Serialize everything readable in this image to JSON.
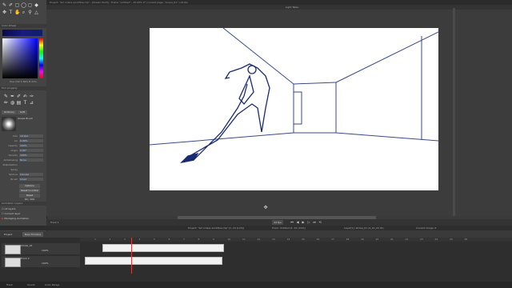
{
  "window": {
    "title": "Project: \"art orders workflow.clip\" - [Dream Paint] - Frame \"untitled\" - 25.00% 0° (current page: \"scene_01\" ) 24 fps",
    "canvas_title": "Light Table"
  },
  "tools": [
    "pen-icon",
    "pencil-icon",
    "brush-icon",
    "eraser-icon",
    "select-icon",
    "fill-icon",
    "move-icon",
    "text-icon",
    "hand-icon",
    "zoom-icon",
    "eyedropper-icon",
    "figure-icon"
  ],
  "color": {
    "header": "Color Wheel",
    "readout": "Hue 232 S 89% B 22%",
    "main_swatch": "#0d1f6d"
  },
  "brush": {
    "header": "Tool property",
    "tabs": [
      "Ordinary",
      "Soft"
    ],
    "name": "Gisela Brush",
    "props": [
      {
        "label": "Size",
        "value": "10.0px"
      },
      {
        "label": "AA",
        "value": "0.00%"
      },
      {
        "label": "Opacity",
        "value": "100%"
      },
      {
        "label": "Angle",
        "value": "0.00°"
      },
      {
        "label": "Density",
        "value": "100%"
      },
      {
        "label": "Antialiasing",
        "value": "None"
      },
      {
        "label": "Stabilization",
        "value": ""
      },
      {
        "label": "Spray",
        "value": ""
      },
      {
        "label": "Texture",
        "value": "Canvas"
      },
      {
        "label": "Brush",
        "value": "Lined"
      }
    ],
    "buttons": [
      "Options",
      "Reset to initial",
      "Reset"
    ],
    "footer": "90 / 100"
  },
  "layers": {
    "header": "Animation Layers",
    "items": [
      "All layers",
      "Current layer",
      "Managing Animation"
    ]
  },
  "timeline": {
    "track_label": "Track 1",
    "fps": "24 fps",
    "controls": [
      "first-frame-icon",
      "prev-frame-icon",
      "play-icon",
      "next-frame-icon",
      "last-frame-icon",
      "loop-icon"
    ],
    "info": [
      "Project: \"art orders workflow.clip\" [1, 24 (123)]",
      "Track: Untitled [1, 24 (123)]",
      "Layer[1]: stroke_01 (4_10_24 01)",
      "Current image: 6"
    ],
    "tabs": [
      "Project",
      "New Timeline"
    ],
    "tracks": [
      {
        "name": "stroke_01",
        "opacity": "100%"
      },
      {
        "name": "Track 2",
        "opacity": "100%"
      }
    ],
    "ruler": [
      "1",
      "2",
      "3",
      "4",
      "5",
      "6",
      "7",
      "8",
      "9",
      "10",
      "11",
      "12",
      "13",
      "14",
      "15",
      "16",
      "17",
      "18",
      "19",
      "20",
      "21",
      "22",
      "23",
      "24",
      "25",
      "26"
    ]
  },
  "status": [
    "Track",
    "Sound",
    "Color Range"
  ]
}
